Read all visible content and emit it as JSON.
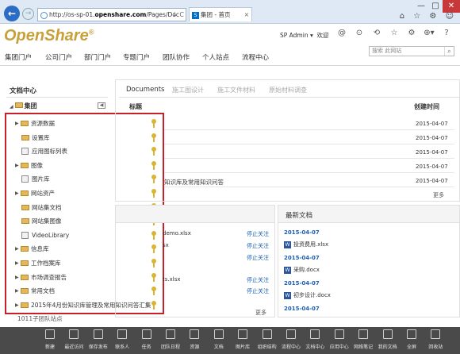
{
  "browser": {
    "url_prefix": "http://os-sp-01.",
    "url_host": "openshare.com",
    "url_rest": "/Pages/Doc",
    "url_controls": "↓ C",
    "tab_title": "集团 - 首页",
    "window_controls": [
      "—",
      "□",
      "✕"
    ],
    "tool_icons": "⌂ ☆ ⚙ ☺"
  },
  "header": {
    "logo_text": "OpenShare",
    "logo_mark": "®",
    "user": "SP Admin ▾",
    "welcome": "欢迎",
    "icons": [
      "@",
      "⊙",
      "⟲",
      "☆",
      "⚙",
      "⊕▾",
      "?"
    ],
    "search_placeholder": "搜索 此网站",
    "search_icon": "⌕"
  },
  "topnav": [
    "集团门户",
    "公司门户",
    "部门门户",
    "专题门户",
    "团队协作",
    "个人站点",
    "流程中心"
  ],
  "left": {
    "title": "文档中心",
    "root": "集团",
    "items": [
      {
        "label": "资源数据",
        "expandable": true,
        "kind": "folder"
      },
      {
        "label": "设置库",
        "expandable": false,
        "kind": "folder"
      },
      {
        "label": "应用图标列表",
        "expandable": false,
        "kind": "library"
      },
      {
        "label": "图像",
        "expandable": true,
        "kind": "folder"
      },
      {
        "label": "图片库",
        "expandable": false,
        "kind": "library"
      },
      {
        "label": "网站资产",
        "expandable": true,
        "kind": "folder"
      },
      {
        "label": "网站集文档",
        "expandable": false,
        "kind": "folder"
      },
      {
        "label": "网站集图像",
        "expandable": false,
        "kind": "folder"
      },
      {
        "label": "VideoLibrary",
        "expandable": false,
        "kind": "library"
      },
      {
        "label": "信息库",
        "expandable": true,
        "kind": "folder"
      },
      {
        "label": "工作档案库",
        "expandable": true,
        "kind": "folder"
      },
      {
        "label": "市场调查报告",
        "expandable": true,
        "kind": "folder"
      },
      {
        "label": "常用文档",
        "expandable": true,
        "kind": "folder"
      },
      {
        "label": "2015年4月份知识库管理及常用知识问答汇集",
        "expandable": true,
        "kind": "folder"
      }
    ],
    "below_tree": "1011子团队站点"
  },
  "docs": {
    "tabs": [
      "Documents",
      "施工图设计",
      "施工文件材料",
      "原始材料调查"
    ],
    "col_title": "标题",
    "col_time": "创建时间",
    "rows": [
      {
        "title": "",
        "date": "2015-04-07"
      },
      {
        "title": "",
        "date": "2015-04-07"
      },
      {
        "title": "",
        "date": "2015-04-07"
      },
      {
        "title": "",
        "date": "2015-04-07"
      },
      {
        "title": "知识库及常用知识问答",
        "date": "2015-04-07"
      }
    ],
    "more": "更多"
  },
  "follows": {
    "files": [
      "demo.xlsx",
      "sx",
      "",
      "ts.xlsx",
      ""
    ],
    "action": "停止关注",
    "more": "更多"
  },
  "latest": {
    "title": "最新文档",
    "items": [
      {
        "date": "2015-04-07",
        "file": "投资费用.xlsx"
      },
      {
        "date": "2015-04-07",
        "file": "采购.docx"
      },
      {
        "date": "2015-04-07",
        "file": "初步设计.docx"
      },
      {
        "date": "2015-04-07",
        "file": ""
      }
    ]
  },
  "bottombar": [
    "新建",
    "最近访问",
    "保存发布",
    "联系人",
    "任务",
    "团队日程",
    "资源",
    "文档",
    "图片库",
    "组织结构",
    "流程中心",
    "文档中心",
    "应用中心",
    "网络笔记",
    "我的文档",
    "全屏",
    "回收站"
  ]
}
